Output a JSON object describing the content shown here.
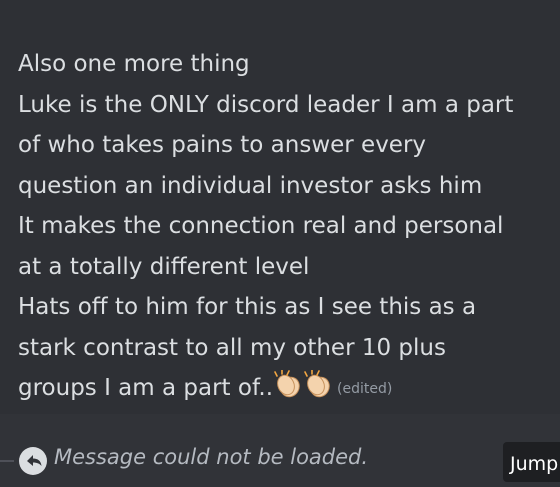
{
  "message": {
    "lines": [
      "Also one more thing",
      "Luke is the ONLY discord leader I am a part",
      "of who takes pains to answer every",
      "question an individual investor asks him",
      "It makes the connection real and personal",
      "at a totally different level",
      "Hats off to him for this as I see  this as a",
      "stark contrast to  all my other  10 plus",
      "groups I am a part of.."
    ],
    "emoji": [
      "clapping-hands",
      "clapping-hands"
    ],
    "edited_label": "(edited)"
  },
  "reply": {
    "status_text": "Message could not be loaded.",
    "icon": "reply-arrow-icon"
  },
  "jump_button": {
    "label": "Jump"
  },
  "colors": {
    "message_bg": "#2e3035",
    "app_bg": "#313338",
    "text": "#dbdee1",
    "muted": "#949ba4",
    "jump_bg": "#1e1f22"
  }
}
